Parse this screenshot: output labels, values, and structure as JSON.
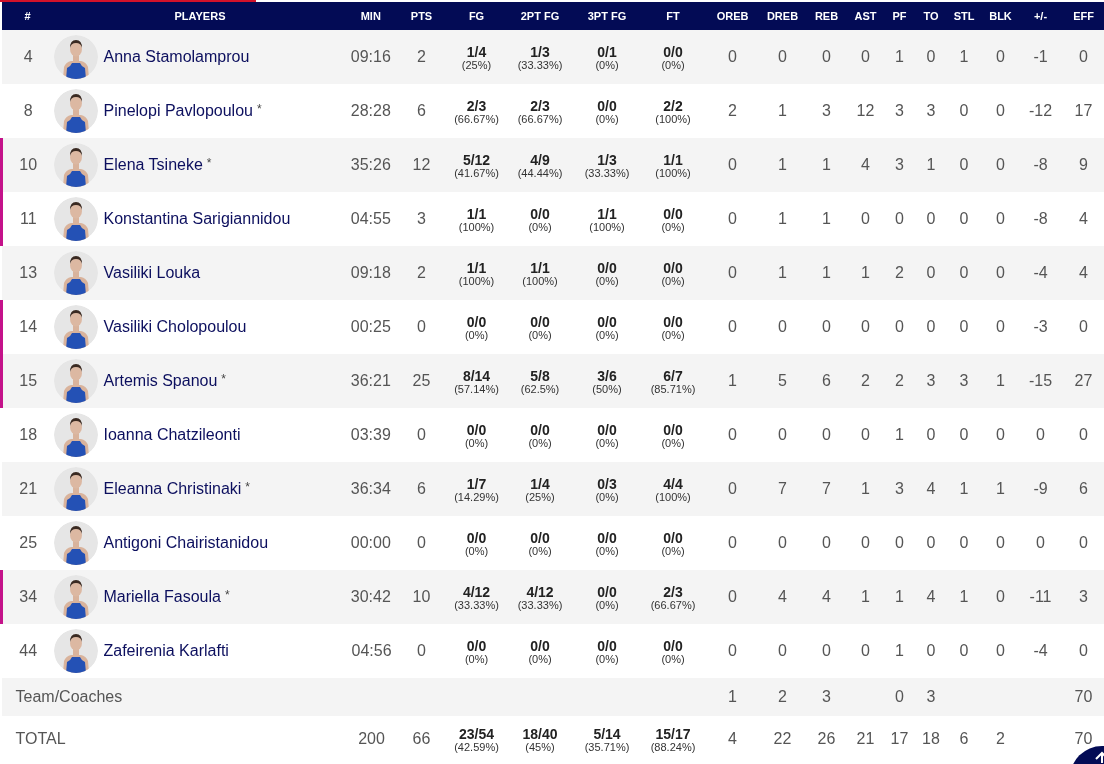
{
  "columns": [
    "#",
    "PLAYERS",
    "MIN",
    "PTS",
    "FG",
    "2PT FG",
    "3PT FG",
    "FT",
    "OREB",
    "DREB",
    "REB",
    "AST",
    "PF",
    "TO",
    "STL",
    "BLK",
    "+/-",
    "EFF"
  ],
  "players": [
    {
      "number": "4",
      "name": "Anna Stamolamprou",
      "highlighted": false,
      "min": "09:16",
      "pts": "2",
      "shooting": [
        {
          "value": "1/4",
          "pct": "(25%)"
        },
        {
          "value": "1/3",
          "pct": "(33.33%)"
        },
        {
          "value": "0/1",
          "pct": "(0%)"
        },
        {
          "value": "0/0",
          "pct": "(0%)"
        }
      ],
      "stats": [
        "0",
        "0",
        "0",
        "0",
        "1",
        "0",
        "1",
        "0",
        "-1",
        "0"
      ]
    },
    {
      "number": "8",
      "name": "Pinelopi Pavlopoulou",
      "mark": "*",
      "highlighted": false,
      "min": "28:28",
      "pts": "6",
      "shooting": [
        {
          "value": "2/3",
          "pct": "(66.67%)"
        },
        {
          "value": "2/3",
          "pct": "(66.67%)"
        },
        {
          "value": "0/0",
          "pct": "(0%)"
        },
        {
          "value": "2/2",
          "pct": "(100%)"
        }
      ],
      "stats": [
        "2",
        "1",
        "3",
        "12",
        "3",
        "3",
        "0",
        "0",
        "-12",
        "17"
      ]
    },
    {
      "number": "10",
      "name": "Elena Tsineke",
      "mark": "*",
      "highlighted": true,
      "min": "35:26",
      "pts": "12",
      "shooting": [
        {
          "value": "5/12",
          "pct": "(41.67%)"
        },
        {
          "value": "4/9",
          "pct": "(44.44%)"
        },
        {
          "value": "1/3",
          "pct": "(33.33%)"
        },
        {
          "value": "1/1",
          "pct": "(100%)"
        }
      ],
      "stats": [
        "0",
        "1",
        "1",
        "4",
        "3",
        "1",
        "0",
        "0",
        "-8",
        "9"
      ]
    },
    {
      "number": "11",
      "name": "Konstantina Sarigiannidou",
      "highlighted": true,
      "min": "04:55",
      "pts": "3",
      "shooting": [
        {
          "value": "1/1",
          "pct": "(100%)"
        },
        {
          "value": "0/0",
          "pct": "(0%)"
        },
        {
          "value": "1/1",
          "pct": "(100%)"
        },
        {
          "value": "0/0",
          "pct": "(0%)"
        }
      ],
      "stats": [
        "0",
        "1",
        "1",
        "0",
        "0",
        "0",
        "0",
        "0",
        "-8",
        "4"
      ]
    },
    {
      "number": "13",
      "name": "Vasiliki Louka",
      "highlighted": false,
      "min": "09:18",
      "pts": "2",
      "shooting": [
        {
          "value": "1/1",
          "pct": "(100%)"
        },
        {
          "value": "1/1",
          "pct": "(100%)"
        },
        {
          "value": "0/0",
          "pct": "(0%)"
        },
        {
          "value": "0/0",
          "pct": "(0%)"
        }
      ],
      "stats": [
        "0",
        "1",
        "1",
        "1",
        "2",
        "0",
        "0",
        "0",
        "-4",
        "4"
      ]
    },
    {
      "number": "14",
      "name": "Vasiliki Cholopoulou",
      "highlighted": true,
      "min": "00:25",
      "pts": "0",
      "shooting": [
        {
          "value": "0/0",
          "pct": "(0%)"
        },
        {
          "value": "0/0",
          "pct": "(0%)"
        },
        {
          "value": "0/0",
          "pct": "(0%)"
        },
        {
          "value": "0/0",
          "pct": "(0%)"
        }
      ],
      "stats": [
        "0",
        "0",
        "0",
        "0",
        "0",
        "0",
        "0",
        "0",
        "-3",
        "0"
      ]
    },
    {
      "number": "15",
      "name": "Artemis Spanou",
      "mark": "*",
      "highlighted": true,
      "min": "36:21",
      "pts": "25",
      "shooting": [
        {
          "value": "8/14",
          "pct": "(57.14%)"
        },
        {
          "value": "5/8",
          "pct": "(62.5%)"
        },
        {
          "value": "3/6",
          "pct": "(50%)"
        },
        {
          "value": "6/7",
          "pct": "(85.71%)"
        }
      ],
      "stats": [
        "1",
        "5",
        "6",
        "2",
        "2",
        "3",
        "3",
        "1",
        "-15",
        "27"
      ]
    },
    {
      "number": "18",
      "name": "Ioanna Chatzileonti",
      "highlighted": false,
      "min": "03:39",
      "pts": "0",
      "shooting": [
        {
          "value": "0/0",
          "pct": "(0%)"
        },
        {
          "value": "0/0",
          "pct": "(0%)"
        },
        {
          "value": "0/0",
          "pct": "(0%)"
        },
        {
          "value": "0/0",
          "pct": "(0%)"
        }
      ],
      "stats": [
        "0",
        "0",
        "0",
        "0",
        "1",
        "0",
        "0",
        "0",
        "0",
        "0"
      ]
    },
    {
      "number": "21",
      "name": "Eleanna Christinaki",
      "mark": "*",
      "highlighted": false,
      "min": "36:34",
      "pts": "6",
      "shooting": [
        {
          "value": "1/7",
          "pct": "(14.29%)"
        },
        {
          "value": "1/4",
          "pct": "(25%)"
        },
        {
          "value": "0/3",
          "pct": "(0%)"
        },
        {
          "value": "4/4",
          "pct": "(100%)"
        }
      ],
      "stats": [
        "0",
        "7",
        "7",
        "1",
        "3",
        "4",
        "1",
        "1",
        "-9",
        "6"
      ]
    },
    {
      "number": "25",
      "name": "Antigoni Chairistanidou",
      "highlighted": false,
      "min": "00:00",
      "pts": "0",
      "shooting": [
        {
          "value": "0/0",
          "pct": "(0%)"
        },
        {
          "value": "0/0",
          "pct": "(0%)"
        },
        {
          "value": "0/0",
          "pct": "(0%)"
        },
        {
          "value": "0/0",
          "pct": "(0%)"
        }
      ],
      "stats": [
        "0",
        "0",
        "0",
        "0",
        "0",
        "0",
        "0",
        "0",
        "0",
        "0"
      ]
    },
    {
      "number": "34",
      "name": "Mariella Fasoula",
      "mark": "*",
      "highlighted": true,
      "min": "30:42",
      "pts": "10",
      "shooting": [
        {
          "value": "4/12",
          "pct": "(33.33%)"
        },
        {
          "value": "4/12",
          "pct": "(33.33%)"
        },
        {
          "value": "0/0",
          "pct": "(0%)"
        },
        {
          "value": "2/3",
          "pct": "(66.67%)"
        }
      ],
      "stats": [
        "0",
        "4",
        "4",
        "1",
        "1",
        "4",
        "1",
        "0",
        "-11",
        "3"
      ]
    },
    {
      "number": "44",
      "name": "Zafeirenia Karlafti",
      "highlighted": false,
      "min": "04:56",
      "pts": "0",
      "shooting": [
        {
          "value": "0/0",
          "pct": "(0%)"
        },
        {
          "value": "0/0",
          "pct": "(0%)"
        },
        {
          "value": "0/0",
          "pct": "(0%)"
        },
        {
          "value": "0/0",
          "pct": "(0%)"
        }
      ],
      "stats": [
        "0",
        "0",
        "0",
        "0",
        "1",
        "0",
        "0",
        "0",
        "-4",
        "0"
      ]
    }
  ],
  "team_row": {
    "label": "Team/Coaches",
    "stats": {
      "oreb": "1",
      "dreb": "2",
      "reb": "3",
      "pf": "0",
      "to": "3",
      "eff": "70"
    }
  },
  "total_row": {
    "label": "TOTAL",
    "min": "200",
    "pts": "66",
    "shooting": [
      {
        "value": "23/54",
        "pct": "(42.59%)"
      },
      {
        "value": "18/40",
        "pct": "(45%)"
      },
      {
        "value": "5/14",
        "pct": "(35.71%)"
      },
      {
        "value": "15/17",
        "pct": "(88.24%)"
      }
    ],
    "stats": {
      "oreb": "4",
      "dreb": "22",
      "reb": "26",
      "ast": "21",
      "pf": "17",
      "to": "18",
      "stl": "6",
      "blk": "2",
      "eff": "70"
    }
  }
}
